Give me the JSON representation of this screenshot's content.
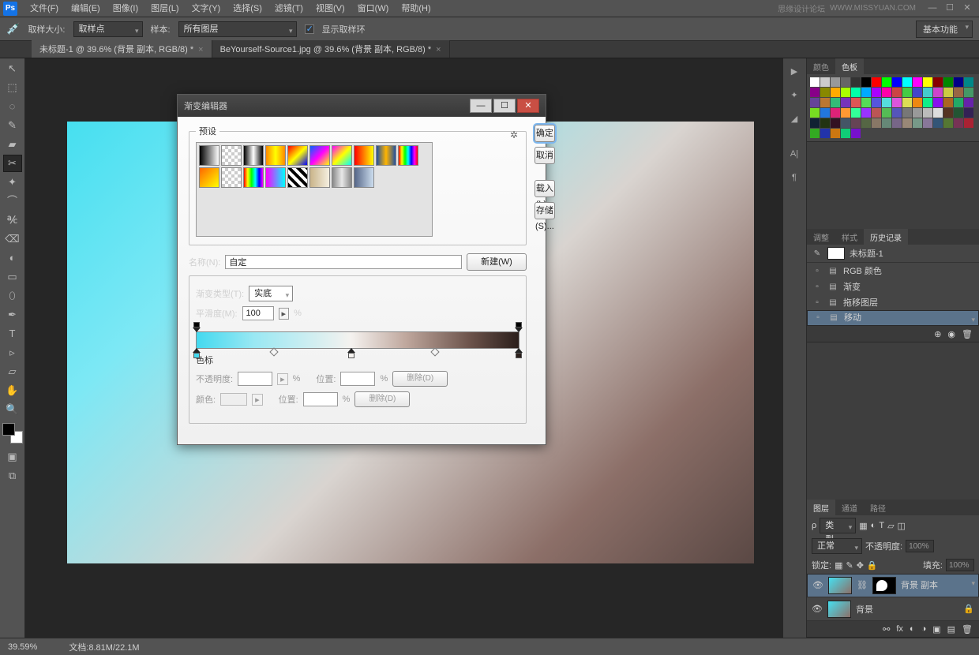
{
  "menu": {
    "items": [
      "文件(F)",
      "编辑(E)",
      "图像(I)",
      "图层(L)",
      "文字(Y)",
      "选择(S)",
      "滤镜(T)",
      "视图(V)",
      "窗口(W)",
      "帮助(H)"
    ],
    "brand": "思缘设计论坛",
    "url": "WWW.MISSYUAN.COM"
  },
  "options": {
    "sampleSizeLbl": "取样大小:",
    "sampleSizeVal": "取样点",
    "sampleLbl": "样本:",
    "sampleVal": "所有图层",
    "ringLbl": "显示取样环",
    "workspace": "基本功能"
  },
  "tabs": [
    {
      "label": "未标题-1 @ 39.6% (背景 副本, RGB/8) *",
      "active": true
    },
    {
      "label": "BeYourself-Source1.jpg @ 39.6% (背景 副本, RGB/8) *",
      "active": false
    }
  ],
  "tools": [
    "↖",
    "⬚",
    "◌",
    "✎",
    "▰",
    "✂",
    "✦",
    "⌒",
    "℀",
    "⌫",
    "◐",
    "▭",
    "⬯",
    "✒",
    "T",
    "▹",
    "▱",
    "✋",
    "🔍"
  ],
  "swatchColors": [
    "#fff",
    "#ccc",
    "#999",
    "#666",
    "#333",
    "#000",
    "#f00",
    "#0f0",
    "#00f",
    "#0ff",
    "#f0f",
    "#ff0",
    "#800",
    "#080",
    "#008",
    "#088",
    "#808",
    "#880",
    "#fa0",
    "#af0",
    "#0fa",
    "#0af",
    "#a0f",
    "#f0a",
    "#c44",
    "#4c4",
    "#44c",
    "#4cc",
    "#c4c",
    "#cc4",
    "#964",
    "#496",
    "#649",
    "#b73",
    "#3b7",
    "#73b",
    "#d55",
    "#5d5",
    "#55d",
    "#5dd",
    "#d5d",
    "#dd5",
    "#e81",
    "#1e8",
    "#81e",
    "#a62",
    "#2a6",
    "#62a",
    "#7d2",
    "#27d",
    "#d27",
    "#f93",
    "#3f9",
    "#93f",
    "#b55",
    "#5b5",
    "#55b",
    "#777",
    "#999",
    "#bbb",
    "#ddd",
    "#532",
    "#253",
    "#325",
    "#123",
    "#231",
    "#312",
    "#456",
    "#645",
    "#564",
    "#876",
    "#687",
    "#768",
    "#987",
    "#798",
    "#879",
    "#357",
    "#573",
    "#735",
    "#a23",
    "#3a2",
    "#23a",
    "#c71",
    "#1c7",
    "#71c"
  ],
  "panels": {
    "colorTabs": [
      "颜色",
      "色板"
    ],
    "adjustTabs": [
      "调整",
      "样式",
      "历史记录"
    ],
    "history": {
      "docName": "未标题-1",
      "items": [
        "RGB 颜色",
        "渐变",
        "拖移图层",
        "移动"
      ],
      "selected": 3
    },
    "layersTabs": [
      "图层",
      "通道",
      "路径"
    ],
    "layers": {
      "kindLbl": "类型",
      "blendVal": "正常",
      "opLbl": "不透明度:",
      "opVal": "100%",
      "lockLbl": "锁定:",
      "fillLbl": "填充:",
      "fillVal": "100%",
      "rows": [
        {
          "name": "背景 副本",
          "sel": true,
          "mask": true
        },
        {
          "name": "背景",
          "sel": false,
          "mask": false,
          "locked": true
        }
      ]
    }
  },
  "status": {
    "zoom": "39.59%",
    "doc": "文档:8.81M/22.1M"
  },
  "dialog": {
    "title": "渐变编辑器",
    "buttons": {
      "ok": "确定",
      "cancel": "取消",
      "load": "载入(L)...",
      "save": "存储(S)..."
    },
    "presetsLbl": "预设",
    "presets": [
      [
        "linear-gradient(90deg,#000,#fff)",
        "repeating-conic-gradient(#ccc 0 25%,#fff 0 50%) 0 0/8px 8px",
        "linear-gradient(90deg,#000,#fff,#000)",
        "linear-gradient(90deg,#f80,#ff0,#f80)",
        "linear-gradient(135deg,#f00,#ff0,#00f)",
        "linear-gradient(135deg,#06f,#f0f,#ff0)",
        "linear-gradient(135deg,#f0f,#ff0,#0ff)",
        "linear-gradient(90deg,#f00,#ff0)",
        "linear-gradient(90deg,#2050a0,#ffb400,#2050a0)",
        "linear-gradient(90deg,#f00,#ff0,#0f0,#0ff,#00f,#f0f,#f00)"
      ],
      [
        "linear-gradient(135deg,#f60,#ff0)",
        "repeating-conic-gradient(#ccc 0 25%,#fff 0 50%) 0 0/8px 8px",
        "linear-gradient(90deg,#f00,#ff0,#0f0,#0ff,#00f,#f0f)",
        "linear-gradient(90deg,#f0f,#0ff)",
        "repeating-linear-gradient(45deg,#000 0 4px,#fff 4px 8px)",
        "linear-gradient(90deg,#c9b48a,#f5efe0)",
        "linear-gradient(90deg,#888,#e8e8e8,#888)",
        "linear-gradient(90deg,#568,#cde)",
        "",
        ""
      ]
    ],
    "nameLbl": "名称(N):",
    "nameVal": "自定",
    "newBtn": "新建(W)",
    "typeLbl": "渐变类型(T):",
    "typeVal": "实底",
    "smoothLbl": "平滑度(M):",
    "smoothVal": "100",
    "pct": "%",
    "stopsLbl": "色标",
    "opacityLbl": "不透明度:",
    "posLbl": "位置:",
    "colorLbl": "颜色:",
    "deleteLbl": "删除(D)",
    "opacityVal": "",
    "posVal1": "",
    "posVal2": "",
    "gradStops": {
      "opTop": [
        0,
        100
      ],
      "colBot": [
        {
          "p": 0,
          "c": "#43d9ef"
        },
        {
          "p": 48,
          "c": "#f5f2ef"
        },
        {
          "p": 100,
          "c": "#2b1f1b"
        }
      ],
      "mid": [
        24,
        74
      ]
    }
  }
}
